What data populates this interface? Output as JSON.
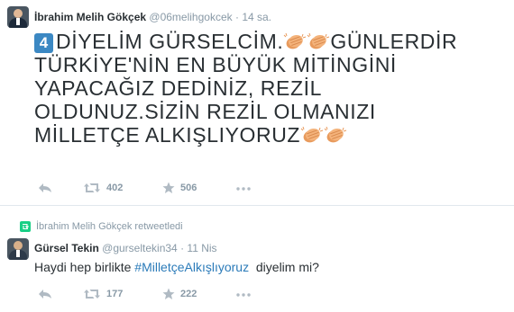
{
  "tweet1": {
    "fullname": "İbrahim Melih Gökçek",
    "username": "@06melihgokcek",
    "separator": "·",
    "time": "14 sa.",
    "keycap": "4",
    "line1a": "DİYELİM GÜRSELCİM.",
    "line1b": "GÜNLERDİR",
    "line2": "TÜRKİYE'NİN EN BÜYÜK MİTİNGİNİ",
    "line3": "YAPACAĞIZ DEDİNİZ, REZİL",
    "line4": "OLDUNUZ.SİZİN REZİL OLMANIZI",
    "line5": "MİLLETÇE ALKIŞLIYORUZ",
    "retweets": "402",
    "favorites": "506"
  },
  "retweet_context": {
    "text": "İbrahim Melih Gökçek retweetledi"
  },
  "tweet2": {
    "fullname": "Gürsel Tekin",
    "username": "@gurseltekin34",
    "separator": "·",
    "time": "11 Nis",
    "text_before": "Haydi hep birlikte ",
    "hashtag": "#MilletçeAlkışlıyoruz",
    "text_after": "  diyelim mi?",
    "retweets": "177",
    "favorites": "222"
  },
  "colors": {
    "link": "#2b7bb9",
    "muted": "#8899a6",
    "retweet_green": "#19cf86",
    "keycap_blue": "#3b88c3",
    "clap": "#f4b37b"
  },
  "icons": [
    "reply-icon",
    "retweet-icon",
    "favorite-star-icon",
    "more-dots-icon",
    "clapping-hands-icon",
    "keycap-4-icon"
  ]
}
